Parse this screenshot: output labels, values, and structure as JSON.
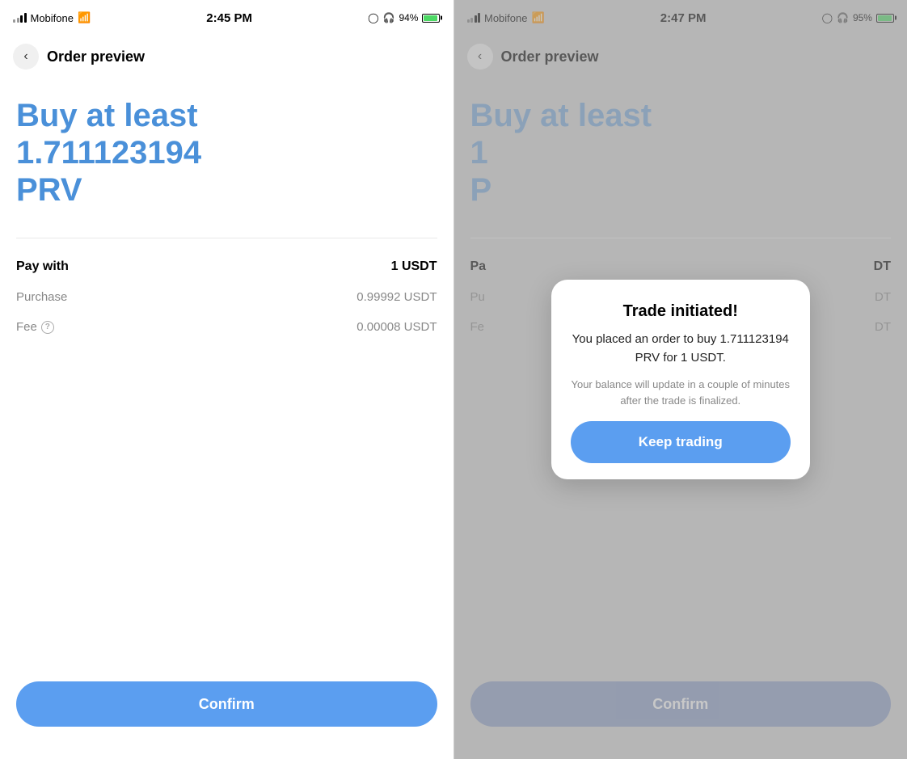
{
  "left": {
    "statusBar": {
      "carrier": "Mobifone",
      "time": "2:45 PM",
      "battery": "94%"
    },
    "nav": {
      "backLabel": "<",
      "title": "Order preview"
    },
    "heading": {
      "line1": "Buy at least",
      "line2": "1.711123194",
      "line3": "PRV"
    },
    "details": {
      "payWithLabel": "Pay with",
      "payWithValue": "1 USDT",
      "purchaseLabel": "Purchase",
      "purchaseValue": "0.99992 USDT",
      "feeLabel": "Fee",
      "feeValue": "0.00008 USDT"
    },
    "confirmLabel": "Confirm"
  },
  "right": {
    "statusBar": {
      "carrier": "Mobifone",
      "time": "2:47 PM",
      "battery": "95%"
    },
    "nav": {
      "backLabel": "<",
      "title": "Order preview"
    },
    "heading": {
      "line1": "Buy at least",
      "line2": "1",
      "line3": "P"
    },
    "details": {
      "payWithLabel": "Pa",
      "payWithValue": "DT",
      "purchaseLabel": "Pu",
      "purchaseValue": "DT",
      "feeLabel": "Fe",
      "feeValue": "DT"
    },
    "confirmLabel": "Confirm",
    "modal": {
      "title": "Trade initiated!",
      "body": "You placed an order to buy 1.711123194 PRV for 1 USDT.",
      "sub": "Your balance will update in a couple of minutes after the trade is finalized.",
      "keepTradingLabel": "Keep trading"
    }
  }
}
